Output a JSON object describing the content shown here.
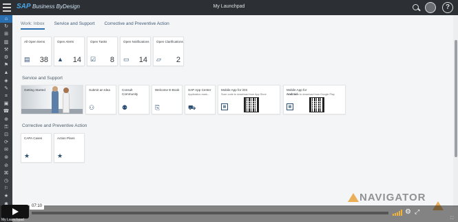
{
  "shell": {
    "logo_main": "SAP",
    "logo_sub": "Business ByDesign",
    "title": "My Launchpad",
    "help_glyph": "?"
  },
  "rail": {
    "items": [
      "⌂",
      "↻",
      "⊞",
      "▥",
      "⚒",
      "⚙",
      "⚑",
      "▲",
      "◈",
      "✎",
      "⌗",
      "▣",
      "☎",
      "⊕",
      "⚿",
      "⊡",
      "⟳",
      "✉",
      "⊛",
      "⊘",
      "⌘",
      "◷",
      "⚐",
      "★",
      "✱"
    ]
  },
  "tabs": [
    {
      "label": "Work: Inbox",
      "active": true
    },
    {
      "label": "Service and Support",
      "active": false
    },
    {
      "label": "Corrective and Preventive Action",
      "active": false
    }
  ],
  "inbox": {
    "tiles": [
      {
        "title": "All Open Items",
        "icon": "list-icon",
        "glyph": "▤",
        "count": "38"
      },
      {
        "title": "Open Alerts",
        "icon": "alert-icon",
        "glyph": "▲",
        "count": "14"
      },
      {
        "title": "Open Tasks",
        "icon": "task-icon",
        "glyph": "☑",
        "count": "8"
      },
      {
        "title": "Open Notifications",
        "icon": "notification-icon",
        "glyph": "▭",
        "count": "14"
      },
      {
        "title": "Open Clarifications",
        "icon": "clarification-icon",
        "glyph": "▱",
        "count": "2"
      }
    ]
  },
  "service": {
    "title": "Service and Support",
    "getting_started": "Getting Started",
    "submit_idea": "Submit an Idea",
    "consult_community": "Consult Community",
    "welcome_ebook": "Welcome E-Book",
    "sap_app_center": {
      "title": "SAP App Center",
      "sub": "Application mark..."
    },
    "mobile_ios": {
      "title": "Mobile App for iOS",
      "sub": "Scan code to download from App Store"
    },
    "mobile_android": {
      "title": "Mobile App for Android",
      "sub": "Scan code to download from Google Play"
    }
  },
  "capa": {
    "title": "Corrective and Preventive Action",
    "tiles": [
      {
        "title": "CAPA Cases"
      },
      {
        "title": "Action Plans"
      }
    ]
  },
  "watermark": "NAVIGATOR",
  "player": {
    "time": "07:10",
    "progress": 0.0,
    "footer": "My Launchpad"
  }
}
